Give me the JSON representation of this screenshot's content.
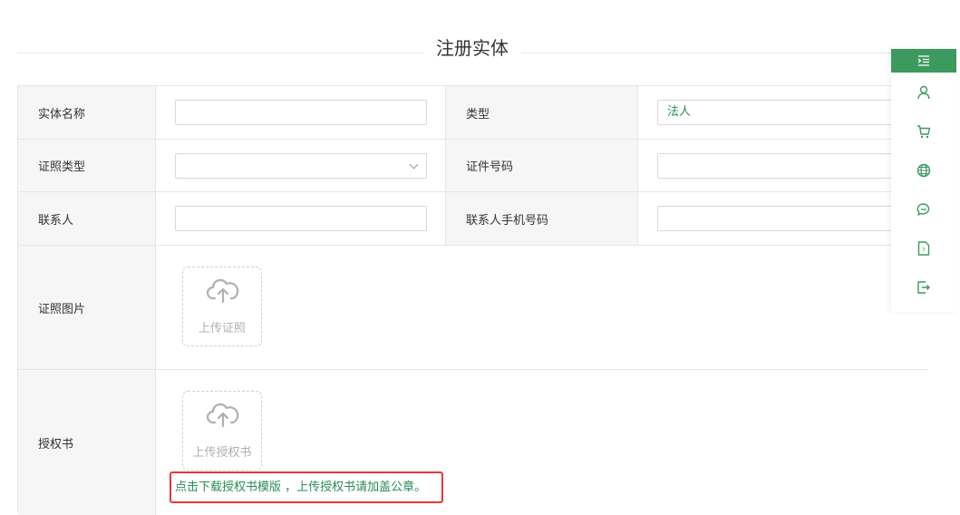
{
  "page": {
    "title": "注册实体"
  },
  "form": {
    "entity_name": {
      "label": "实体名称",
      "value": ""
    },
    "type": {
      "label": "类型",
      "value": "法人"
    },
    "cert_type": {
      "label": "证照类型",
      "value": ""
    },
    "cert_number": {
      "label": "证件号码",
      "value": ""
    },
    "contact": {
      "label": "联系人",
      "value": ""
    },
    "contact_phone": {
      "label": "联系人手机号码",
      "value": ""
    },
    "cert_image": {
      "label": "证照图片",
      "upload_text": "上传证照"
    },
    "authorization": {
      "label": "授权书",
      "upload_text": "上传授权书"
    },
    "notice_link": "点击下载授权书模版",
    "notice_text": " ，上传授权书请加盖公章。"
  },
  "sidebar": {
    "items": [
      {
        "icon": "menu-indent-icon"
      },
      {
        "icon": "user-icon"
      },
      {
        "icon": "cart-icon"
      },
      {
        "icon": "globe-icon"
      },
      {
        "icon": "chat-icon"
      },
      {
        "icon": "help-document-icon"
      },
      {
        "icon": "logout-icon"
      }
    ]
  },
  "colors": {
    "accent": "#3c9a5f",
    "link": "#2a8c55",
    "highlight_border": "#e53935",
    "label_bg": "#f6f6f6"
  }
}
